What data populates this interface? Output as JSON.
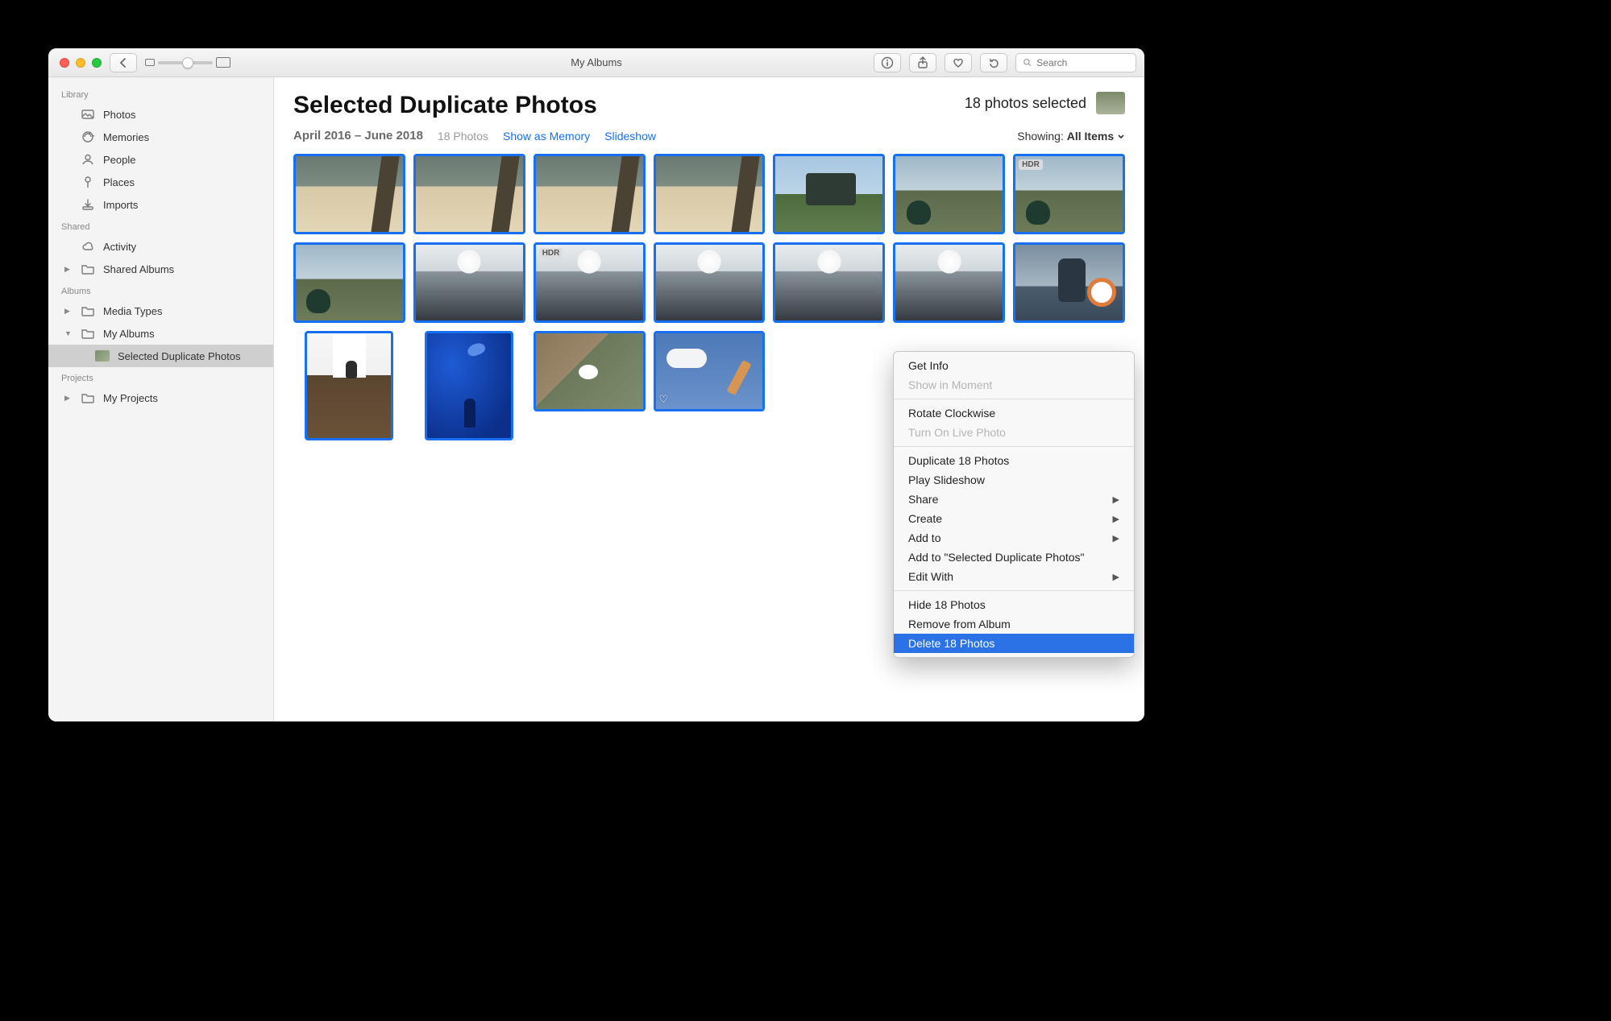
{
  "window_title": "My Albums",
  "search_placeholder": "Search",
  "sidebar": {
    "sections": [
      {
        "header": "Library",
        "items": [
          {
            "label": "Photos",
            "icon": "photos"
          },
          {
            "label": "Memories",
            "icon": "memories"
          },
          {
            "label": "People",
            "icon": "people"
          },
          {
            "label": "Places",
            "icon": "places"
          },
          {
            "label": "Imports",
            "icon": "imports"
          }
        ]
      },
      {
        "header": "Shared",
        "items": [
          {
            "label": "Activity",
            "icon": "cloud"
          },
          {
            "label": "Shared Albums",
            "icon": "folder",
            "disclosure": "right"
          }
        ]
      },
      {
        "header": "Albums",
        "items": [
          {
            "label": "Media Types",
            "icon": "folder",
            "disclosure": "right"
          },
          {
            "label": "My Albums",
            "icon": "folder",
            "disclosure": "down",
            "children": [
              {
                "label": "Selected Duplicate Photos",
                "icon": "album",
                "selected": true
              }
            ]
          }
        ]
      },
      {
        "header": "Projects",
        "items": [
          {
            "label": "My Projects",
            "icon": "folder",
            "disclosure": "right"
          }
        ]
      }
    ]
  },
  "main": {
    "title": "Selected Duplicate Photos",
    "selection_count_text": "18 photos selected",
    "date_range": "April 2016 – June 2018",
    "photo_count_text": "18 Photos",
    "link_memory": "Show as Memory",
    "link_slideshow": "Slideshow",
    "showing_label": "Showing:",
    "showing_value": "All Items",
    "photos": [
      {
        "style": "t-beach",
        "selected": true
      },
      {
        "style": "t-beach",
        "selected": true
      },
      {
        "style": "t-beach",
        "selected": true
      },
      {
        "style": "t-beach",
        "selected": true
      },
      {
        "style": "t-sign",
        "selected": true
      },
      {
        "style": "t-peacock",
        "selected": true
      },
      {
        "style": "t-peacock",
        "selected": true,
        "hdr": true
      },
      {
        "style": "t-peacock",
        "selected": true
      },
      {
        "style": "t-beachscape",
        "selected": true
      },
      {
        "style": "t-beachscape",
        "selected": true,
        "hdr": true
      },
      {
        "style": "t-beachscape",
        "selected": true
      },
      {
        "style": "t-beachscape",
        "selected": true
      },
      {
        "style": "t-beachscape",
        "selected": true
      },
      {
        "style": "t-sail",
        "selected": true
      },
      {
        "style": "t-stairs",
        "selected": true,
        "portrait": true
      },
      {
        "style": "t-aquarium",
        "selected": true,
        "portrait": true
      },
      {
        "style": "t-swan",
        "selected": true
      },
      {
        "style": "t-sky",
        "selected": true,
        "favorite": true
      }
    ]
  },
  "context_menu": {
    "items": [
      {
        "label": "Get Info"
      },
      {
        "label": "Show in Moment",
        "disabled": true
      },
      {
        "sep": true
      },
      {
        "label": "Rotate Clockwise"
      },
      {
        "label": "Turn On Live Photo",
        "disabled": true
      },
      {
        "sep": true
      },
      {
        "label": "Duplicate 18 Photos"
      },
      {
        "label": "Play Slideshow"
      },
      {
        "label": "Share",
        "submenu": true
      },
      {
        "label": "Create",
        "submenu": true
      },
      {
        "label": "Add to",
        "submenu": true
      },
      {
        "label": "Add to \"Selected Duplicate Photos\""
      },
      {
        "label": "Edit With",
        "submenu": true
      },
      {
        "sep": true
      },
      {
        "label": "Hide 18 Photos"
      },
      {
        "label": "Remove from Album"
      },
      {
        "label": "Delete 18 Photos",
        "highlighted": true
      }
    ]
  },
  "badges": {
    "hdr": "HDR"
  }
}
